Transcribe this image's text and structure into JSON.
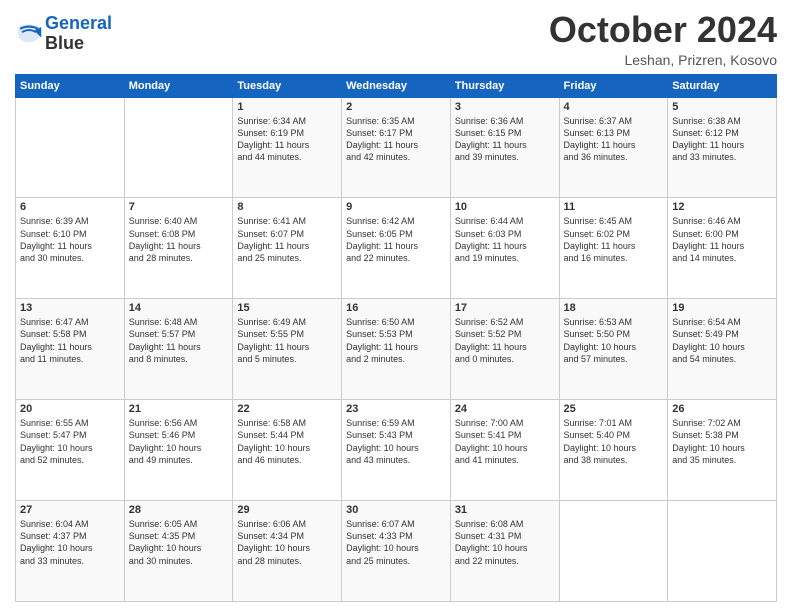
{
  "header": {
    "logo_line1": "General",
    "logo_line2": "Blue",
    "month": "October 2024",
    "location": "Leshan, Prizren, Kosovo"
  },
  "weekdays": [
    "Sunday",
    "Monday",
    "Tuesday",
    "Wednesday",
    "Thursday",
    "Friday",
    "Saturday"
  ],
  "rows": [
    [
      {
        "day": "",
        "content": ""
      },
      {
        "day": "",
        "content": ""
      },
      {
        "day": "1",
        "content": "Sunrise: 6:34 AM\nSunset: 6:19 PM\nDaylight: 11 hours\nand 44 minutes."
      },
      {
        "day": "2",
        "content": "Sunrise: 6:35 AM\nSunset: 6:17 PM\nDaylight: 11 hours\nand 42 minutes."
      },
      {
        "day": "3",
        "content": "Sunrise: 6:36 AM\nSunset: 6:15 PM\nDaylight: 11 hours\nand 39 minutes."
      },
      {
        "day": "4",
        "content": "Sunrise: 6:37 AM\nSunset: 6:13 PM\nDaylight: 11 hours\nand 36 minutes."
      },
      {
        "day": "5",
        "content": "Sunrise: 6:38 AM\nSunset: 6:12 PM\nDaylight: 11 hours\nand 33 minutes."
      }
    ],
    [
      {
        "day": "6",
        "content": "Sunrise: 6:39 AM\nSunset: 6:10 PM\nDaylight: 11 hours\nand 30 minutes."
      },
      {
        "day": "7",
        "content": "Sunrise: 6:40 AM\nSunset: 6:08 PM\nDaylight: 11 hours\nand 28 minutes."
      },
      {
        "day": "8",
        "content": "Sunrise: 6:41 AM\nSunset: 6:07 PM\nDaylight: 11 hours\nand 25 minutes."
      },
      {
        "day": "9",
        "content": "Sunrise: 6:42 AM\nSunset: 6:05 PM\nDaylight: 11 hours\nand 22 minutes."
      },
      {
        "day": "10",
        "content": "Sunrise: 6:44 AM\nSunset: 6:03 PM\nDaylight: 11 hours\nand 19 minutes."
      },
      {
        "day": "11",
        "content": "Sunrise: 6:45 AM\nSunset: 6:02 PM\nDaylight: 11 hours\nand 16 minutes."
      },
      {
        "day": "12",
        "content": "Sunrise: 6:46 AM\nSunset: 6:00 PM\nDaylight: 11 hours\nand 14 minutes."
      }
    ],
    [
      {
        "day": "13",
        "content": "Sunrise: 6:47 AM\nSunset: 5:58 PM\nDaylight: 11 hours\nand 11 minutes."
      },
      {
        "day": "14",
        "content": "Sunrise: 6:48 AM\nSunset: 5:57 PM\nDaylight: 11 hours\nand 8 minutes."
      },
      {
        "day": "15",
        "content": "Sunrise: 6:49 AM\nSunset: 5:55 PM\nDaylight: 11 hours\nand 5 minutes."
      },
      {
        "day": "16",
        "content": "Sunrise: 6:50 AM\nSunset: 5:53 PM\nDaylight: 11 hours\nand 2 minutes."
      },
      {
        "day": "17",
        "content": "Sunrise: 6:52 AM\nSunset: 5:52 PM\nDaylight: 11 hours\nand 0 minutes."
      },
      {
        "day": "18",
        "content": "Sunrise: 6:53 AM\nSunset: 5:50 PM\nDaylight: 10 hours\nand 57 minutes."
      },
      {
        "day": "19",
        "content": "Sunrise: 6:54 AM\nSunset: 5:49 PM\nDaylight: 10 hours\nand 54 minutes."
      }
    ],
    [
      {
        "day": "20",
        "content": "Sunrise: 6:55 AM\nSunset: 5:47 PM\nDaylight: 10 hours\nand 52 minutes."
      },
      {
        "day": "21",
        "content": "Sunrise: 6:56 AM\nSunset: 5:46 PM\nDaylight: 10 hours\nand 49 minutes."
      },
      {
        "day": "22",
        "content": "Sunrise: 6:58 AM\nSunset: 5:44 PM\nDaylight: 10 hours\nand 46 minutes."
      },
      {
        "day": "23",
        "content": "Sunrise: 6:59 AM\nSunset: 5:43 PM\nDaylight: 10 hours\nand 43 minutes."
      },
      {
        "day": "24",
        "content": "Sunrise: 7:00 AM\nSunset: 5:41 PM\nDaylight: 10 hours\nand 41 minutes."
      },
      {
        "day": "25",
        "content": "Sunrise: 7:01 AM\nSunset: 5:40 PM\nDaylight: 10 hours\nand 38 minutes."
      },
      {
        "day": "26",
        "content": "Sunrise: 7:02 AM\nSunset: 5:38 PM\nDaylight: 10 hours\nand 35 minutes."
      }
    ],
    [
      {
        "day": "27",
        "content": "Sunrise: 6:04 AM\nSunset: 4:37 PM\nDaylight: 10 hours\nand 33 minutes."
      },
      {
        "day": "28",
        "content": "Sunrise: 6:05 AM\nSunset: 4:35 PM\nDaylight: 10 hours\nand 30 minutes."
      },
      {
        "day": "29",
        "content": "Sunrise: 6:06 AM\nSunset: 4:34 PM\nDaylight: 10 hours\nand 28 minutes."
      },
      {
        "day": "30",
        "content": "Sunrise: 6:07 AM\nSunset: 4:33 PM\nDaylight: 10 hours\nand 25 minutes."
      },
      {
        "day": "31",
        "content": "Sunrise: 6:08 AM\nSunset: 4:31 PM\nDaylight: 10 hours\nand 22 minutes."
      },
      {
        "day": "",
        "content": ""
      },
      {
        "day": "",
        "content": ""
      }
    ]
  ]
}
